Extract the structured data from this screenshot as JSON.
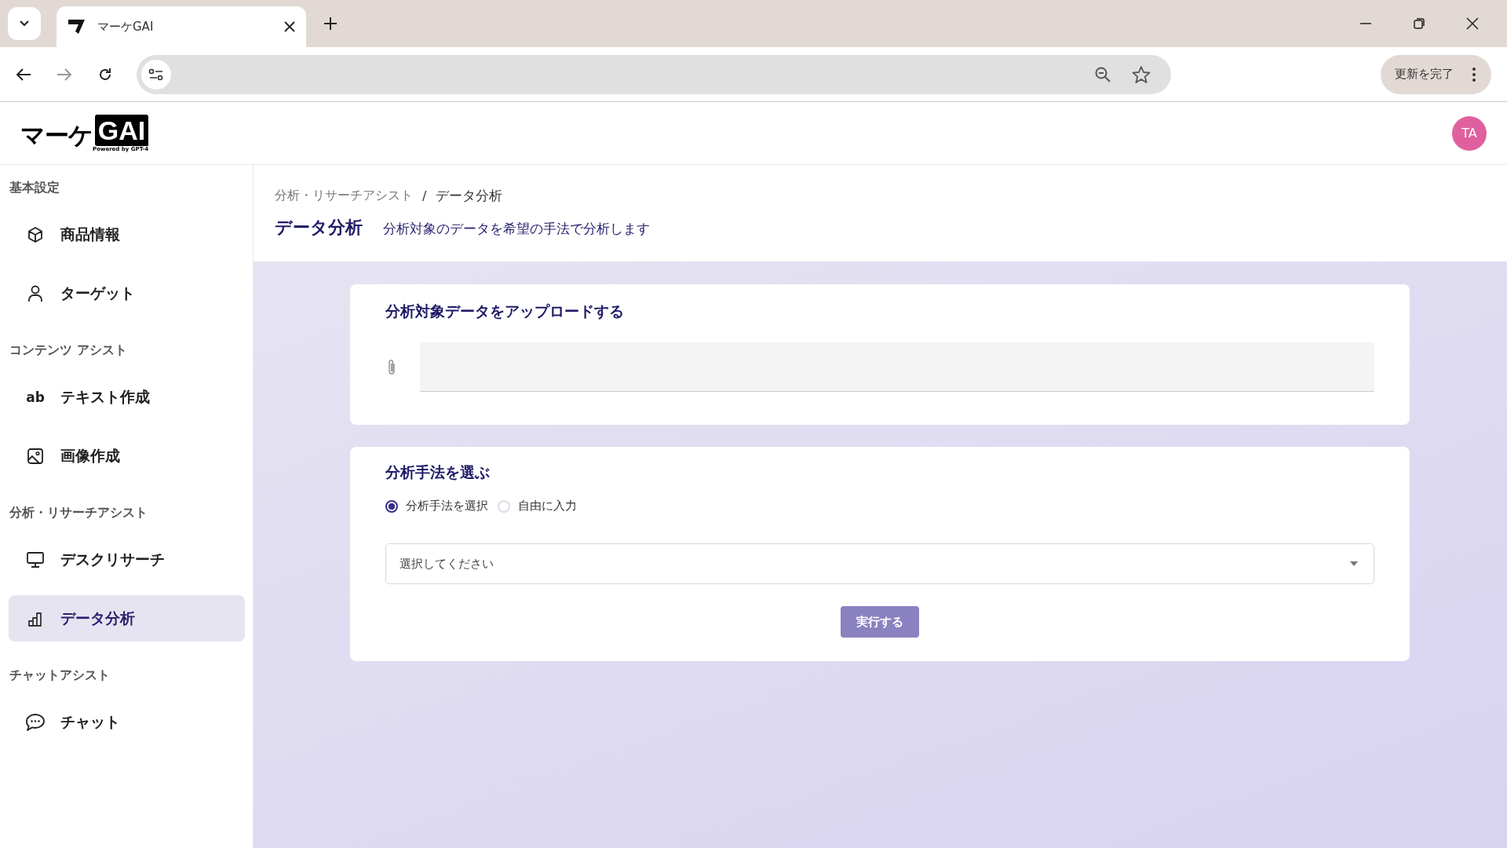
{
  "browser": {
    "tab_title": "マーケGAI",
    "update_button": "更新を完了"
  },
  "app_header": {
    "logo_text": "マーケ",
    "logo_badge": "GAI",
    "logo_tagline": "Powered by GPT-4",
    "avatar": "TA"
  },
  "sidebar": {
    "groups": [
      {
        "label": "基本設定",
        "items": [
          {
            "label": "商品情報",
            "kind": "box",
            "selected": false
          },
          {
            "label": "ターゲット",
            "kind": "person",
            "selected": false
          }
        ]
      },
      {
        "label": "コンテンツ アシスト",
        "items": [
          {
            "label": "テキスト作成",
            "kind": "text",
            "icon_text": "ab",
            "selected": false
          },
          {
            "label": "画像作成",
            "kind": "image",
            "selected": false
          }
        ]
      },
      {
        "label": "分析・リサーチアシスト",
        "items": [
          {
            "label": "デスクリサーチ",
            "kind": "monitor",
            "selected": false
          },
          {
            "label": "データ分析",
            "kind": "chart",
            "selected": true
          }
        ]
      },
      {
        "label": "チャットアシスト",
        "items": [
          {
            "label": "チャット",
            "kind": "chat",
            "selected": false
          }
        ]
      }
    ]
  },
  "breadcrumb": {
    "separator": "/",
    "items": [
      "分析・リサーチアシスト",
      "データ分析"
    ]
  },
  "page": {
    "title": "データ分析",
    "subtitle": "分析対象のデータを希望の手法で分析します"
  },
  "upload_card": {
    "title": "分析対象データをアップロードする"
  },
  "method_card": {
    "title": "分析手法を選ぶ",
    "options": [
      {
        "label": "分析手法を選択",
        "selected": true
      },
      {
        "label": "自由に入力",
        "selected": false
      }
    ],
    "select": {
      "placeholder": "選択してください"
    },
    "run_button": {
      "label": "実行する",
      "disabled": true
    }
  }
}
